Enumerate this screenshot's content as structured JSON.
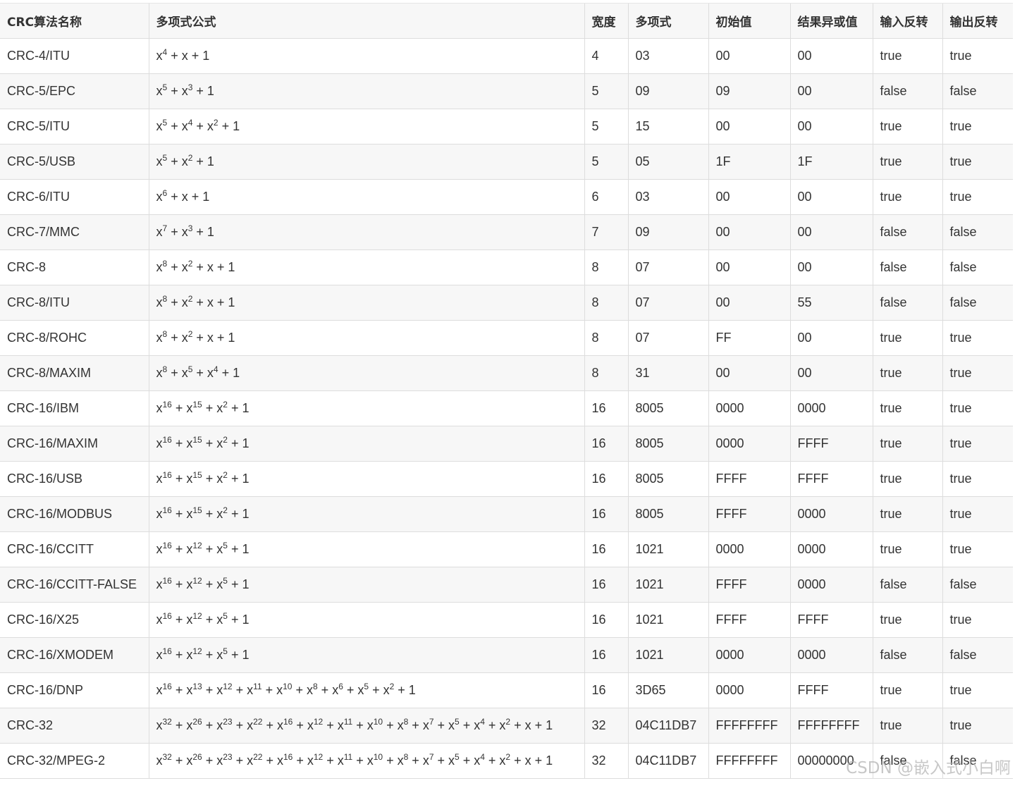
{
  "table": {
    "headers": [
      "CRC算法名称",
      "多项式公式",
      "宽度",
      "多项式",
      "初始值",
      "结果异或值",
      "输入反转",
      "输出反转"
    ],
    "rows": [
      {
        "name": "CRC-4/ITU",
        "terms": [
          [
            "4"
          ],
          [
            "",
            "x"
          ],
          [
            "",
            "1"
          ]
        ],
        "width": "4",
        "poly": "03",
        "init": "00",
        "xorout": "00",
        "refin": "true",
        "refout": "true"
      },
      {
        "name": "CRC-5/EPC",
        "terms": [
          [
            "5"
          ],
          [
            "3"
          ],
          [
            "",
            "1"
          ]
        ],
        "width": "5",
        "poly": "09",
        "init": "09",
        "xorout": "00",
        "refin": "false",
        "refout": "false"
      },
      {
        "name": "CRC-5/ITU",
        "terms": [
          [
            "5"
          ],
          [
            "4"
          ],
          [
            "2"
          ],
          [
            "",
            "1"
          ]
        ],
        "width": "5",
        "poly": "15",
        "init": "00",
        "xorout": "00",
        "refin": "true",
        "refout": "true"
      },
      {
        "name": "CRC-5/USB",
        "terms": [
          [
            "5"
          ],
          [
            "2"
          ],
          [
            "",
            "1"
          ]
        ],
        "width": "5",
        "poly": "05",
        "init": "1F",
        "xorout": "1F",
        "refin": "true",
        "refout": "true"
      },
      {
        "name": "CRC-6/ITU",
        "terms": [
          [
            "6"
          ],
          [
            "",
            "x"
          ],
          [
            "",
            "1"
          ]
        ],
        "width": "6",
        "poly": "03",
        "init": "00",
        "xorout": "00",
        "refin": "true",
        "refout": "true"
      },
      {
        "name": "CRC-7/MMC",
        "terms": [
          [
            "7"
          ],
          [
            "3"
          ],
          [
            "",
            "1"
          ]
        ],
        "width": "7",
        "poly": "09",
        "init": "00",
        "xorout": "00",
        "refin": "false",
        "refout": "false"
      },
      {
        "name": "CRC-8",
        "terms": [
          [
            "8"
          ],
          [
            "2"
          ],
          [
            "",
            "x"
          ],
          [
            "",
            "1"
          ]
        ],
        "width": "8",
        "poly": "07",
        "init": "00",
        "xorout": "00",
        "refin": "false",
        "refout": "false"
      },
      {
        "name": "CRC-8/ITU",
        "terms": [
          [
            "8"
          ],
          [
            "2"
          ],
          [
            "",
            "x"
          ],
          [
            "",
            "1"
          ]
        ],
        "width": "8",
        "poly": "07",
        "init": "00",
        "xorout": "55",
        "refin": "false",
        "refout": "false"
      },
      {
        "name": "CRC-8/ROHC",
        "terms": [
          [
            "8"
          ],
          [
            "2"
          ],
          [
            "",
            "x"
          ],
          [
            "",
            "1"
          ]
        ],
        "width": "8",
        "poly": "07",
        "init": "FF",
        "xorout": "00",
        "refin": "true",
        "refout": "true"
      },
      {
        "name": "CRC-8/MAXIM",
        "terms": [
          [
            "8"
          ],
          [
            "5"
          ],
          [
            "4"
          ],
          [
            "",
            "1"
          ]
        ],
        "width": "8",
        "poly": "31",
        "init": "00",
        "xorout": "00",
        "refin": "true",
        "refout": "true"
      },
      {
        "name": "CRC-16/IBM",
        "terms": [
          [
            "16"
          ],
          [
            "15"
          ],
          [
            "2"
          ],
          [
            "",
            "1"
          ]
        ],
        "width": "16",
        "poly": "8005",
        "init": "0000",
        "xorout": "0000",
        "refin": "true",
        "refout": "true"
      },
      {
        "name": "CRC-16/MAXIM",
        "terms": [
          [
            "16"
          ],
          [
            "15"
          ],
          [
            "2"
          ],
          [
            "",
            "1"
          ]
        ],
        "width": "16",
        "poly": "8005",
        "init": "0000",
        "xorout": "FFFF",
        "refin": "true",
        "refout": "true"
      },
      {
        "name": "CRC-16/USB",
        "terms": [
          [
            "16"
          ],
          [
            "15"
          ],
          [
            "2"
          ],
          [
            "",
            "1"
          ]
        ],
        "width": "16",
        "poly": "8005",
        "init": "FFFF",
        "xorout": "FFFF",
        "refin": "true",
        "refout": "true"
      },
      {
        "name": "CRC-16/MODBUS",
        "terms": [
          [
            "16"
          ],
          [
            "15"
          ],
          [
            "2"
          ],
          [
            "",
            "1"
          ]
        ],
        "width": "16",
        "poly": "8005",
        "init": "FFFF",
        "xorout": "0000",
        "refin": "true",
        "refout": "true"
      },
      {
        "name": "CRC-16/CCITT",
        "terms": [
          [
            "16"
          ],
          [
            "12"
          ],
          [
            "5"
          ],
          [
            "",
            "1"
          ]
        ],
        "width": "16",
        "poly": "1021",
        "init": "0000",
        "xorout": "0000",
        "refin": "true",
        "refout": "true"
      },
      {
        "name": "CRC-16/CCITT-FALSE",
        "terms": [
          [
            "16"
          ],
          [
            "12"
          ],
          [
            "5"
          ],
          [
            "",
            "1"
          ]
        ],
        "width": "16",
        "poly": "1021",
        "init": "FFFF",
        "xorout": "0000",
        "refin": "false",
        "refout": "false"
      },
      {
        "name": "CRC-16/X25",
        "terms": [
          [
            "16"
          ],
          [
            "12"
          ],
          [
            "5"
          ],
          [
            "",
            "1"
          ]
        ],
        "width": "16",
        "poly": "1021",
        "init": "FFFF",
        "xorout": "FFFF",
        "refin": "true",
        "refout": "true"
      },
      {
        "name": "CRC-16/XMODEM",
        "terms": [
          [
            "16"
          ],
          [
            "12"
          ],
          [
            "5"
          ],
          [
            "",
            "1"
          ]
        ],
        "width": "16",
        "poly": "1021",
        "init": "0000",
        "xorout": "0000",
        "refin": "false",
        "refout": "false"
      },
      {
        "name": "CRC-16/DNP",
        "terms": [
          [
            "16"
          ],
          [
            "13"
          ],
          [
            "12"
          ],
          [
            "11"
          ],
          [
            "10"
          ],
          [
            "8"
          ],
          [
            "6"
          ],
          [
            "5"
          ],
          [
            "2"
          ],
          [
            "",
            "1"
          ]
        ],
        "width": "16",
        "poly": "3D65",
        "init": "0000",
        "xorout": "FFFF",
        "refin": "true",
        "refout": "true"
      },
      {
        "name": "CRC-32",
        "terms": [
          [
            "32"
          ],
          [
            "26"
          ],
          [
            "23"
          ],
          [
            "22"
          ],
          [
            "16"
          ],
          [
            "12"
          ],
          [
            "11"
          ],
          [
            "10"
          ],
          [
            "8"
          ],
          [
            "7"
          ],
          [
            "5"
          ],
          [
            "4"
          ],
          [
            "2"
          ],
          [
            "",
            "x"
          ],
          [
            "",
            "1"
          ]
        ],
        "width": "32",
        "poly": "04C11DB7",
        "init": "FFFFFFFF",
        "xorout": "FFFFFFFF",
        "refin": "true",
        "refout": "true"
      },
      {
        "name": "CRC-32/MPEG-2",
        "terms": [
          [
            "32"
          ],
          [
            "26"
          ],
          [
            "23"
          ],
          [
            "22"
          ],
          [
            "16"
          ],
          [
            "12"
          ],
          [
            "11"
          ],
          [
            "10"
          ],
          [
            "8"
          ],
          [
            "7"
          ],
          [
            "5"
          ],
          [
            "4"
          ],
          [
            "2"
          ],
          [
            "",
            "x"
          ],
          [
            "",
            "1"
          ]
        ],
        "width": "32",
        "poly": "04C11DB7",
        "init": "FFFFFFFF",
        "xorout": "00000000",
        "refin": "false",
        "refout": "false"
      }
    ]
  },
  "watermark": "CSDN @嵌入式小白啊"
}
